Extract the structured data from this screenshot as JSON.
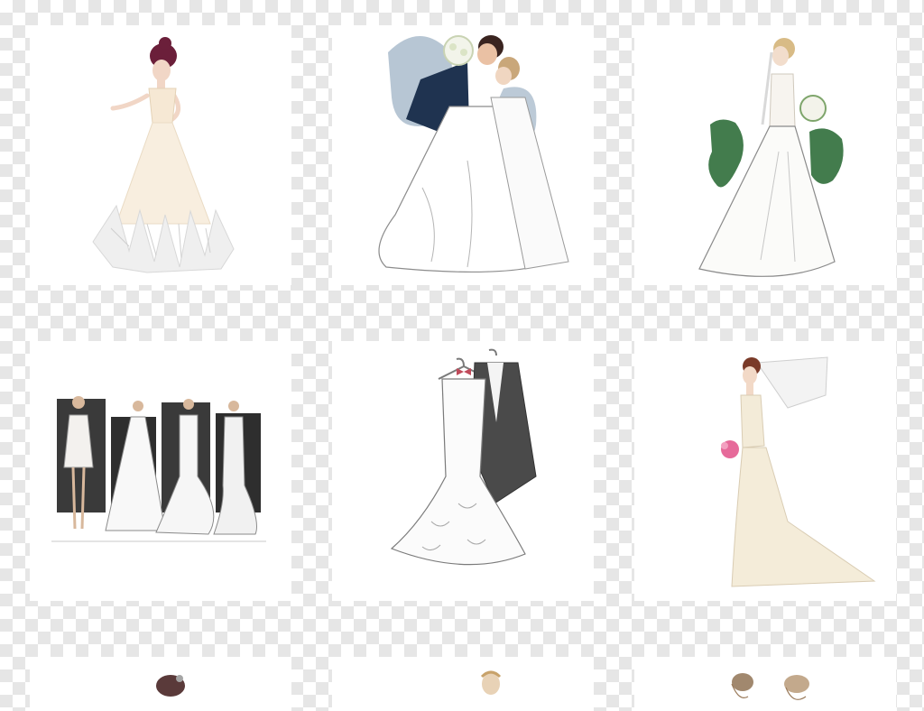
{
  "background": {
    "pattern": "transparency-checkerboard",
    "colors": [
      "#ffffff",
      "#e6e6e6"
    ]
  },
  "gallery": {
    "columns": 3,
    "visible_rows": 3,
    "items": [
      {
        "subject": "bride-ballgown-illustration",
        "accent": "#6b1f3a"
      },
      {
        "subject": "kissing-couple-watercolor",
        "accent": "#1f3350"
      },
      {
        "subject": "bride-with-bouquet-green-watercolor",
        "accent": "#2f6e3a"
      },
      {
        "subject": "four-wedding-dress-sketches",
        "accent": "#3a3a3a"
      },
      {
        "subject": "dress-and-tuxedo-on-hangers",
        "accent": "#c04a5a"
      },
      {
        "subject": "bride-side-profile-veil",
        "accent": "#e66a9a"
      },
      {
        "subject": "bride-partial-top",
        "accent": "#5a3a3a"
      },
      {
        "subject": "figure-partial-top",
        "accent": "#c8a26a"
      },
      {
        "subject": "hairstyle-sketches-partial",
        "accent": "#8a6a4a"
      }
    ]
  }
}
